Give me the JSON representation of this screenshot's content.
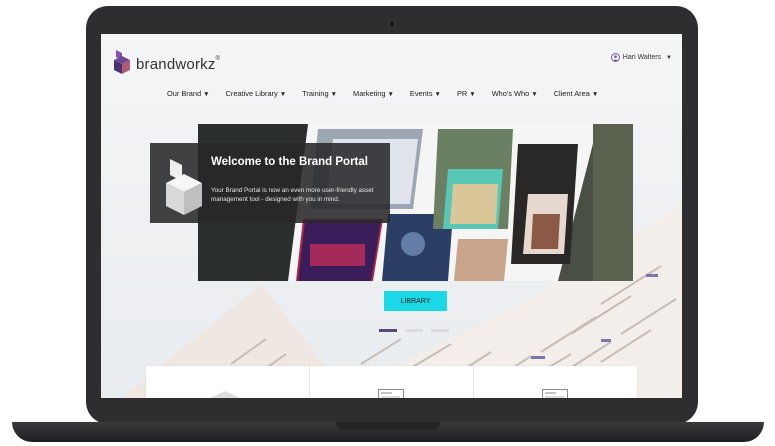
{
  "logo": {
    "text": "brandworkz",
    "tm": "®"
  },
  "user": {
    "name": "Hari Walters",
    "caret": "▼"
  },
  "nav": {
    "items": [
      {
        "label": "Our Brand"
      },
      {
        "label": "Creative Library"
      },
      {
        "label": "Training"
      },
      {
        "label": "Marketing"
      },
      {
        "label": "Events"
      },
      {
        "label": "PR"
      },
      {
        "label": "Who's Who"
      },
      {
        "label": "Client Area"
      }
    ],
    "caret": "▼"
  },
  "hero": {
    "title": "Welcome to the Brand Portal",
    "body": "Your Brand Portal is now an even more user-friendly asset management tool - designed with you in mind."
  },
  "cta": {
    "label": "LIBRARY"
  },
  "carousel": {
    "slides": 3,
    "active_index": 0
  },
  "colors": {
    "accent": "#1ad8e6",
    "brand_purple": "#5a4a7e",
    "laptop": "#2e2e30"
  }
}
